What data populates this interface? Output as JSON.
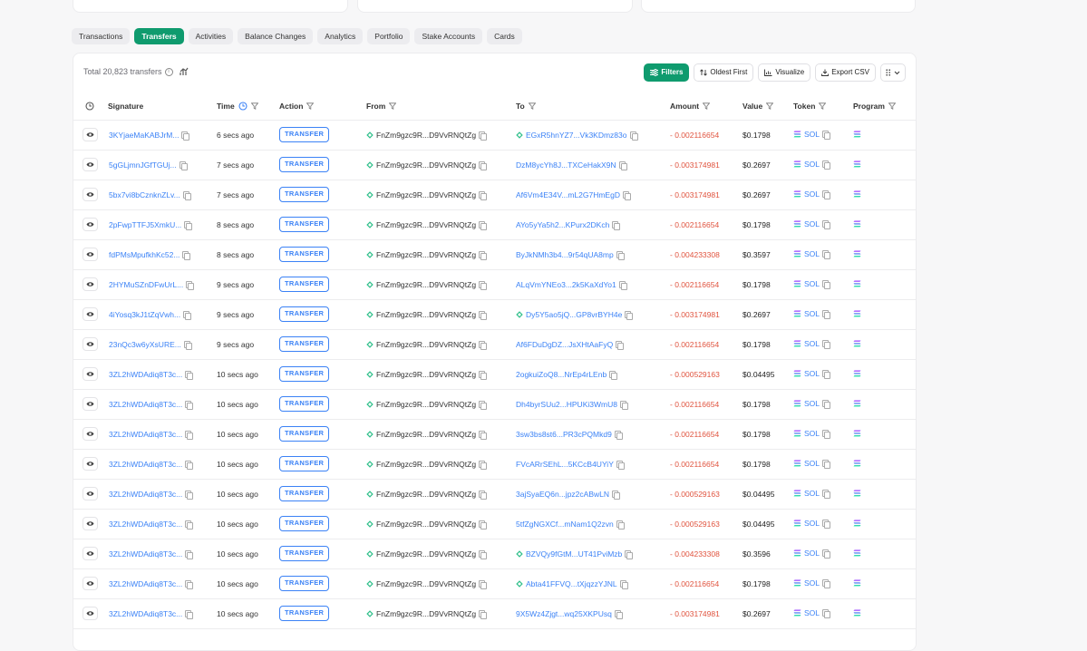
{
  "tabs": [
    "Transactions",
    "Transfers",
    "Activities",
    "Balance Changes",
    "Analytics",
    "Portfolio",
    "Stake Accounts",
    "Cards"
  ],
  "active_tab": "Transfers",
  "toolbar": {
    "total_text": "Total 20,823 transfers",
    "filters_label": "Filters",
    "oldest_label": "Oldest First",
    "visualize_label": "Visualize",
    "export_label": "Export CSV"
  },
  "columns": {
    "signature": "Signature",
    "time": "Time",
    "action": "Action",
    "from": "From",
    "to": "To",
    "amount": "Amount",
    "value": "Value",
    "token": "Token",
    "program": "Program"
  },
  "colors": {
    "accent": "#0f9b6e",
    "link": "#3b82f6",
    "negative": "#e0533e"
  },
  "rows": [
    {
      "signature": "3KYjaeMaKABJrM...",
      "time": "6 secs ago",
      "action": "TRANSFER",
      "from": "FnZm9gzc9R...D9VvRNQtZg",
      "to": "EGxR5hnYZ7...Vk3KDmz83o",
      "to_icon": true,
      "amount": "- 0.002116654",
      "value": "$0.1798",
      "token": "SOL"
    },
    {
      "signature": "5gGLjmnJGfTGUj...",
      "time": "7 secs ago",
      "action": "TRANSFER",
      "from": "FnZm9gzc9R...D9VvRNQtZg",
      "to": "DzM8ycYh8J...TXCeHakX9N",
      "to_icon": false,
      "amount": "- 0.003174981",
      "value": "$0.2697",
      "token": "SOL"
    },
    {
      "signature": "5bx7vi8bCznknZLv...",
      "time": "7 secs ago",
      "action": "TRANSFER",
      "from": "FnZm9gzc9R...D9VvRNQtZg",
      "to": "Af6Vm4E34V...mL2G7HmEgD",
      "to_icon": false,
      "amount": "- 0.003174981",
      "value": "$0.2697",
      "token": "SOL"
    },
    {
      "signature": "2pFwpTTFJ5XmkU...",
      "time": "8 secs ago",
      "action": "TRANSFER",
      "from": "FnZm9gzc9R...D9VvRNQtZg",
      "to": "AYo5yYa5h2...KPurx2DKch",
      "to_icon": false,
      "amount": "- 0.002116654",
      "value": "$0.1798",
      "token": "SOL"
    },
    {
      "signature": "fdPMsMpufkhKc52...",
      "time": "8 secs ago",
      "action": "TRANSFER",
      "from": "FnZm9gzc9R...D9VvRNQtZg",
      "to": "ByJkNMh3b4...9r54qUA8mp",
      "to_icon": false,
      "amount": "- 0.004233308",
      "value": "$0.3597",
      "token": "SOL"
    },
    {
      "signature": "2HYMuSZnDFwUrL...",
      "time": "9 secs ago",
      "action": "TRANSFER",
      "from": "FnZm9gzc9R...D9VvRNQtZg",
      "to": "ALqVmYNEo3...2k5KaXdYo1",
      "to_icon": false,
      "amount": "- 0.002116654",
      "value": "$0.1798",
      "token": "SOL"
    },
    {
      "signature": "4iYosq3kJ1tZqVwh...",
      "time": "9 secs ago",
      "action": "TRANSFER",
      "from": "FnZm9gzc9R...D9VvRNQtZg",
      "to": "Dy5Y5ao5jQ...GP8vrBYH4e",
      "to_icon": true,
      "amount": "- 0.003174981",
      "value": "$0.2697",
      "token": "SOL"
    },
    {
      "signature": "23nQc3w6yXsURE...",
      "time": "9 secs ago",
      "action": "TRANSFER",
      "from": "FnZm9gzc9R...D9VvRNQtZg",
      "to": "Af6FDuDgDZ...JsXHtAaFyQ",
      "to_icon": false,
      "amount": "- 0.002116654",
      "value": "$0.1798",
      "token": "SOL"
    },
    {
      "signature": "3ZL2hWDAdiq8T3c...",
      "time": "10 secs ago",
      "action": "TRANSFER",
      "from": "FnZm9gzc9R...D9VvRNQtZg",
      "to": "2ogkuiZoQ8...NrEp4rLEnb",
      "to_icon": false,
      "amount": "- 0.000529163",
      "value": "$0.04495",
      "token": "SOL"
    },
    {
      "signature": "3ZL2hWDAdiq8T3c...",
      "time": "10 secs ago",
      "action": "TRANSFER",
      "from": "FnZm9gzc9R...D9VvRNQtZg",
      "to": "Dh4byrSUu2...HPUKi3WmU8",
      "to_icon": false,
      "amount": "- 0.002116654",
      "value": "$0.1798",
      "token": "SOL"
    },
    {
      "signature": "3ZL2hWDAdiq8T3c...",
      "time": "10 secs ago",
      "action": "TRANSFER",
      "from": "FnZm9gzc9R...D9VvRNQtZg",
      "to": "3sw3bs8st6...PR3cPQMkd9",
      "to_icon": false,
      "amount": "- 0.002116654",
      "value": "$0.1798",
      "token": "SOL"
    },
    {
      "signature": "3ZL2hWDAdiq8T3c...",
      "time": "10 secs ago",
      "action": "TRANSFER",
      "from": "FnZm9gzc9R...D9VvRNQtZg",
      "to": "FVcARrSEhL...5KCcB4UYiY",
      "to_icon": false,
      "amount": "- 0.002116654",
      "value": "$0.1798",
      "token": "SOL"
    },
    {
      "signature": "3ZL2hWDAdiq8T3c...",
      "time": "10 secs ago",
      "action": "TRANSFER",
      "from": "FnZm9gzc9R...D9VvRNQtZg",
      "to": "3ajSyaEQ6n...jpz2cABwLN",
      "to_icon": false,
      "amount": "- 0.000529163",
      "value": "$0.04495",
      "token": "SOL"
    },
    {
      "signature": "3ZL2hWDAdiq8T3c...",
      "time": "10 secs ago",
      "action": "TRANSFER",
      "from": "FnZm9gzc9R...D9VvRNQtZg",
      "to": "5tfZgNGXCf...mNam1Q2zvn",
      "to_icon": false,
      "amount": "- 0.000529163",
      "value": "$0.04495",
      "token": "SOL"
    },
    {
      "signature": "3ZL2hWDAdiq8T3c...",
      "time": "10 secs ago",
      "action": "TRANSFER",
      "from": "FnZm9gzc9R...D9VvRNQtZg",
      "to": "BZVQy9fGtM...UT41PviMzb",
      "to_icon": true,
      "amount": "- 0.004233308",
      "value": "$0.3596",
      "token": "SOL"
    },
    {
      "signature": "3ZL2hWDAdiq8T3c...",
      "time": "10 secs ago",
      "action": "TRANSFER",
      "from": "FnZm9gzc9R...D9VvRNQtZg",
      "to": "Abta41FFVQ...tXjqzzYJNL",
      "to_icon": true,
      "amount": "- 0.002116654",
      "value": "$0.1798",
      "token": "SOL"
    },
    {
      "signature": "3ZL2hWDAdiq8T3c...",
      "time": "10 secs ago",
      "action": "TRANSFER",
      "from": "FnZm9gzc9R...D9VvRNQtZg",
      "to": "9X5Wz4Zjgt...wq25XKPUsq",
      "to_icon": false,
      "amount": "- 0.003174981",
      "value": "$0.2697",
      "token": "SOL"
    }
  ]
}
